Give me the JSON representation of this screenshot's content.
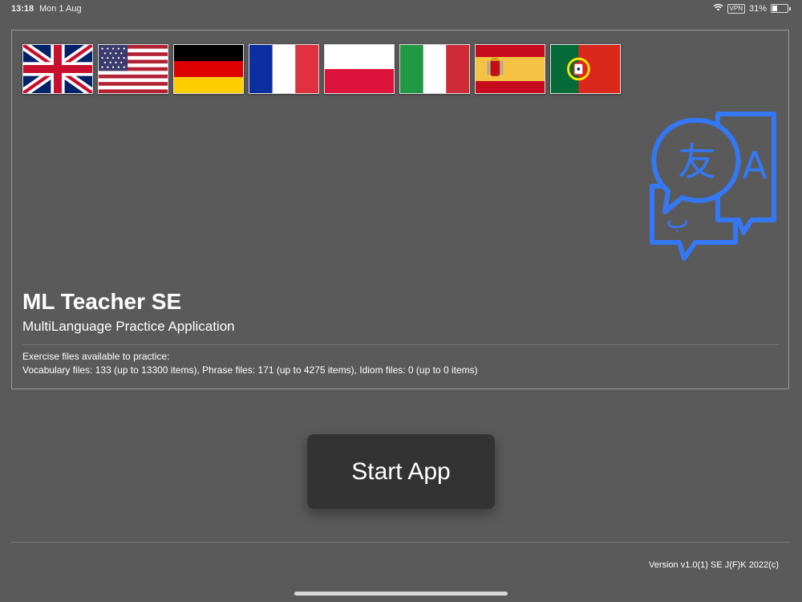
{
  "status_bar": {
    "time": "13:18",
    "date": "Mon 1 Aug",
    "vpn": "VPN",
    "battery": "31%",
    "battery_level": 0.31,
    "icons": [
      "wifi-icon",
      "vpn-badge",
      "battery-icon"
    ]
  },
  "flags": [
    {
      "name": "flag-uk"
    },
    {
      "name": "flag-us"
    },
    {
      "name": "flag-germany"
    },
    {
      "name": "flag-france"
    },
    {
      "name": "flag-poland"
    },
    {
      "name": "flag-italy"
    },
    {
      "name": "flag-spain"
    },
    {
      "name": "flag-portugal"
    }
  ],
  "header": {
    "title": "ML Teacher SE",
    "subtitle": "MultiLanguage Practice Application",
    "icon": "translate-icon",
    "icon_glyphs": {
      "han": "友",
      "latin": "A",
      "arabic": "ب"
    },
    "accent": "#3478f6"
  },
  "files": {
    "heading": "Exercise files available to practice:",
    "counts": "Vocabulary files: 133 (up to 13300 items), Phrase files: 171 (up to 4275 items), Idiom files: 0 (up to 0 items)"
  },
  "start_button": {
    "label": "Start App"
  },
  "footer": {
    "version": "Version v1.0(1) SE J(F)K 2022(c)"
  }
}
